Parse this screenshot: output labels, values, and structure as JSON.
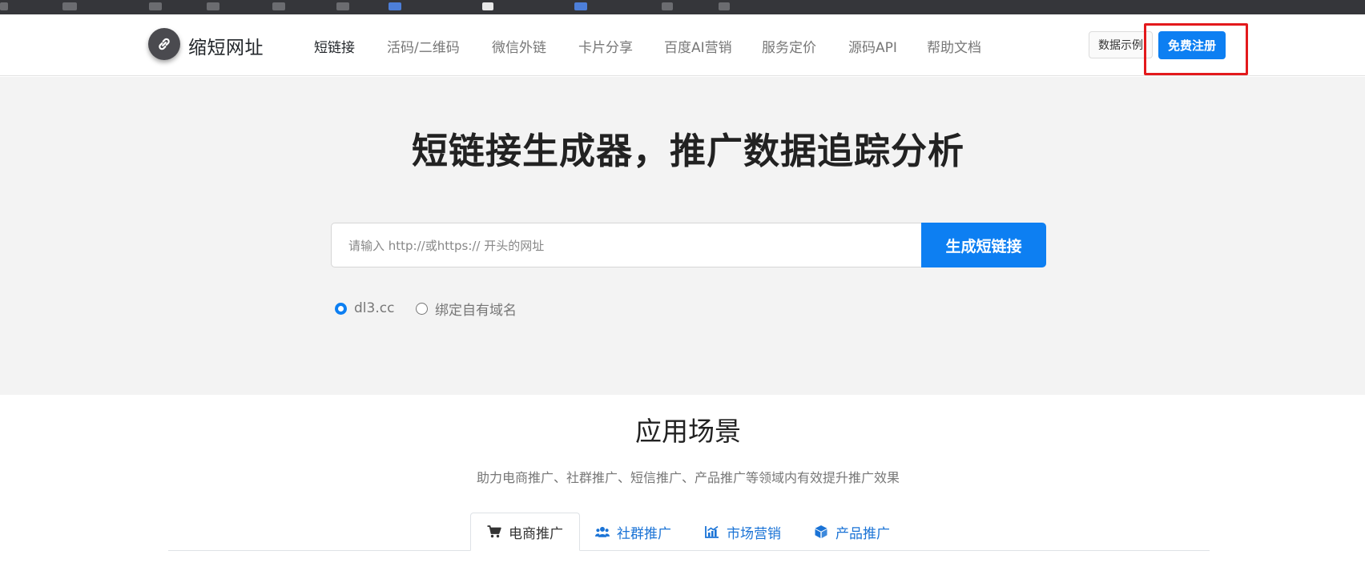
{
  "header": {
    "brand": "缩短网址",
    "nav": [
      {
        "label": "短链接",
        "active": true
      },
      {
        "label": "活码/二维码",
        "active": false
      },
      {
        "label": "微信外链",
        "active": false
      },
      {
        "label": "卡片分享",
        "active": false
      },
      {
        "label": "百度AI营销",
        "active": false
      },
      {
        "label": "服务定价",
        "active": false
      },
      {
        "label": "源码API",
        "active": false
      },
      {
        "label": "帮助文档",
        "active": false
      }
    ],
    "demo_button": "数据示例",
    "register_button": "免费注册"
  },
  "hero": {
    "title": "短链接生成器，推广数据追踪分析",
    "input_placeholder": "请输入 http://或https:// 开头的网址",
    "generate_button": "生成短链接",
    "domain_options": [
      {
        "label": "dl3.cc",
        "checked": true
      },
      {
        "label": "绑定自有域名",
        "checked": false
      }
    ]
  },
  "scenarios": {
    "title": "应用场景",
    "subtitle": "助力电商推广、社群推广、短信推广、产品推广等领域内有效提升推广效果",
    "tabs": [
      {
        "label": "电商推广",
        "icon": "cart-icon",
        "active": true
      },
      {
        "label": "社群推广",
        "icon": "users-icon",
        "active": false
      },
      {
        "label": "市场营销",
        "icon": "chart-icon",
        "active": false
      },
      {
        "label": "产品推广",
        "icon": "cube-icon",
        "active": false
      }
    ]
  },
  "colors": {
    "primary": "#0d7ff2",
    "highlight": "#e3191c",
    "hero_bg": "#f3f3f3"
  }
}
